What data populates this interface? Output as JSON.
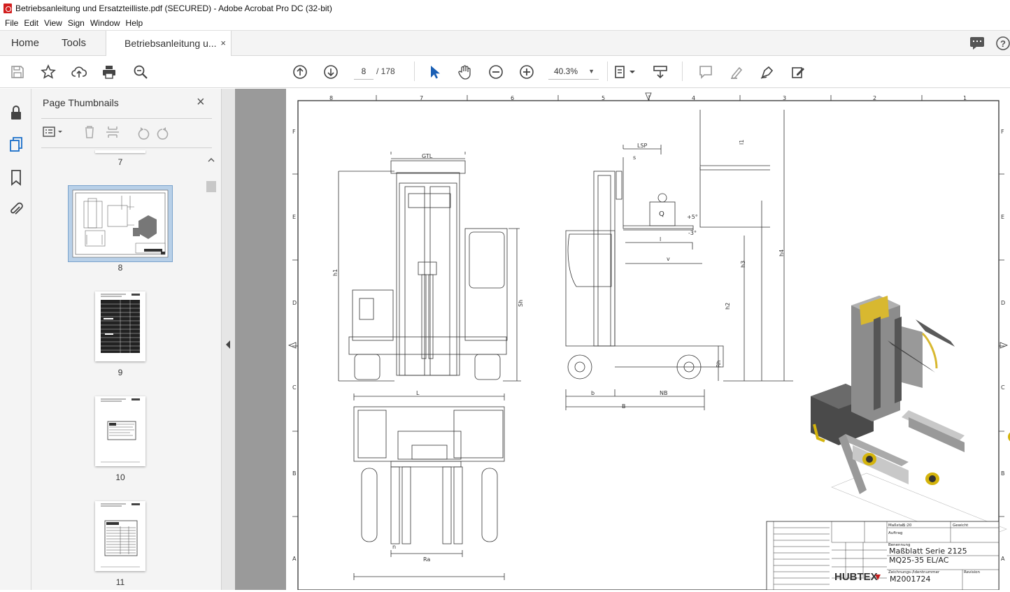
{
  "window": {
    "title": "Betriebsanleitung und Ersatzteilliste.pdf (SECURED) - Adobe Acrobat Pro DC (32-bit)"
  },
  "menu": [
    "File",
    "Edit",
    "View",
    "Sign",
    "Window",
    "Help"
  ],
  "tabs": {
    "home": "Home",
    "tools": "Tools",
    "document": "Betriebsanleitung u...",
    "close": "×"
  },
  "toolbar": {
    "page_current": "8",
    "page_total": "/ 178",
    "zoom": "40.3%"
  },
  "sidebar": {
    "title": "Page Thumbnails",
    "close": "×"
  },
  "thumbnails": [
    {
      "label": "7"
    },
    {
      "label": "8"
    },
    {
      "label": "9"
    },
    {
      "label": "10"
    },
    {
      "label": "11"
    }
  ],
  "drawing": {
    "columns": [
      "8",
      "7",
      "6",
      "5",
      "4",
      "3",
      "2",
      "1"
    ],
    "rows": [
      "F",
      "E",
      "D",
      "C",
      "B",
      "A"
    ],
    "dims": {
      "gtl": "GTL",
      "lsp": "LSP",
      "s": "s",
      "q": "Q",
      "plus5": "+5°",
      "minus3": "-3°",
      "l_small": "l",
      "v": "v",
      "l1": "l1",
      "h1": "h1",
      "sh": "Sh",
      "h2": "h2",
      "h3": "h3",
      "h4": "h4",
      "rh": "Rh",
      "b": "b",
      "nb": "NB",
      "b_total": "B",
      "l_len": "L",
      "ra": "Ra",
      "n": "n"
    },
    "titleblock": {
      "benennung": "Benennung",
      "title1": "Maßblatt Serie 2125",
      "title2": "MQ25-35 EL/AC",
      "zeichnung_label": "Zeichnungs-/Identnummer",
      "number": "M2001724",
      "revision": "Revision",
      "massstab": "Maßstab",
      "scale": "1:20",
      "gewicht": "Gewicht",
      "auftrag": "Auftrag",
      "logo": "HUBTEX"
    }
  }
}
